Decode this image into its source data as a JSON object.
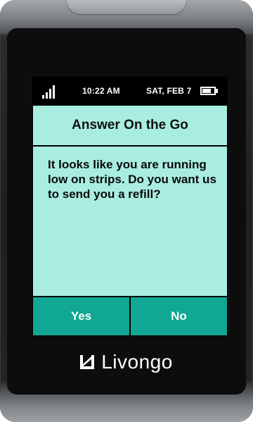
{
  "status_bar": {
    "time": "10:22 AM",
    "date": "SAT, FEB 7",
    "signal_bars": 4,
    "battery_level": 0.75
  },
  "dialog": {
    "title": "Answer On the Go",
    "message": "It looks like you are running low on strips. Do you want us to send you a refill?",
    "yes_label": "Yes",
    "no_label": "No"
  },
  "brand": {
    "name": "Livongo",
    "logo_icon": "livongo-logo-icon"
  },
  "colors": {
    "screen_background": "#a9ede1",
    "button_background": "#10a894",
    "button_text": "#ffffff",
    "device_face": "#0d0d0e"
  }
}
